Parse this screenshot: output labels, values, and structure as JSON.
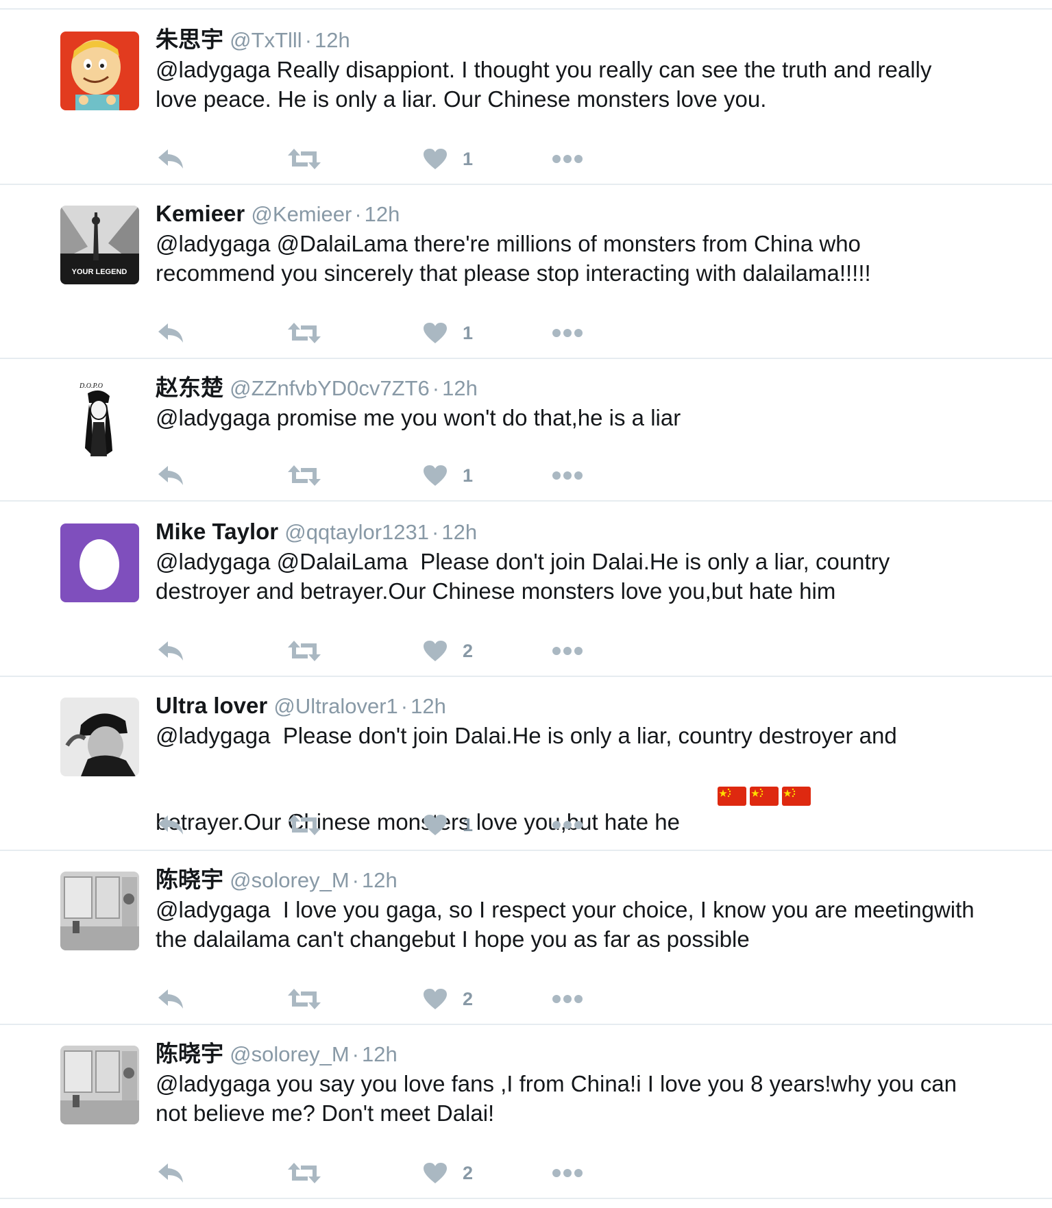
{
  "colors": {
    "name": "#14171a",
    "meta": "#8899a6",
    "icon": "#aab8c2",
    "divider": "#e6ecf0"
  },
  "icons": {
    "reply": "reply-icon",
    "retweet": "retweet-icon",
    "like": "heart-icon",
    "more": "more-icon"
  },
  "tweets": [
    {
      "name": "朱思宇",
      "handle": "@TxTlll",
      "sep": "·",
      "time": "12h",
      "text": "@ladygaga Really disappiont. I thought you really can see the truth and really love peace. He is only a liar. Our Chinese monsters love you.",
      "likes": "1",
      "avatar": "cartoon-avatar"
    },
    {
      "name": "Kemieer",
      "handle": "@Kemieer",
      "sep": "·",
      "time": "12h",
      "text": "@ladygaga @DalaiLama there're millions of monsters from China who recommend you sincerely that please stop interacting with dalailama!!!!!",
      "likes": "1",
      "avatar": "photo-avatar",
      "avatar_caption": "YOUR LEGEND"
    },
    {
      "name": "赵东楚",
      "handle": "@ZZnfvbYD0cv7ZT6",
      "sep": "·",
      "time": "12h",
      "text": "@ladygaga promise me you won't do that,he is a liar",
      "likes": "1",
      "avatar": "sketch-avatar",
      "avatar_caption": "D.O.P.O"
    },
    {
      "name": "Mike Taylor",
      "handle": "@qqtaylor1231",
      "sep": "·",
      "time": "12h",
      "text": "@ladygaga @DalaiLama  Please don't join Dalai.He is only a liar, country destroyer and betrayer.Our Chinese monsters love you,but hate him",
      "likes": "2",
      "avatar": "egg-avatar"
    },
    {
      "name": "Ultra lover",
      "handle": "@Ultralover1",
      "sep": "·",
      "time": "12h",
      "text": "@ladygaga  Please don't join Dalai.He is only a liar, country destroyer and betrayer.Our Chinese monsters love you,but hate he",
      "likes": "1",
      "avatar": "photo-avatar",
      "flags": 3
    },
    {
      "name": "陈晓宇",
      "handle": "@solorey_M",
      "sep": "·",
      "time": "12h",
      "text": "@ladygaga  I love you gaga, so I respect your choice, I know you are meetingwith the dalailama can't changebut I hope you as far as possible",
      "likes": "2",
      "avatar": "room-avatar"
    },
    {
      "name": "陈晓宇",
      "handle": "@solorey_M",
      "sep": "·",
      "time": "12h",
      "text": "@ladygaga you say you love fans ,I from China!i I love you 8 years!why you can not believe me? Don't meet Dalai!",
      "likes": "2",
      "avatar": "room-avatar"
    }
  ]
}
